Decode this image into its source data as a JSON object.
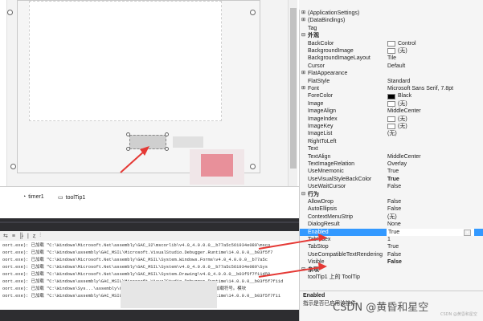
{
  "tray": {
    "items": [
      {
        "icon": "timer-icon",
        "label": "timer1"
      },
      {
        "icon": "tooltip-icon",
        "label": "toolTip1"
      }
    ]
  },
  "output": {
    "toolbar_glyphs": [
      "⇆",
      "≡",
      "╠",
      "|",
      "ȥ",
      "⫶"
    ],
    "lines": [
      "oort.exe): 已加载 \"C:\\Windows\\Microsoft.Net\\assembly\\GAC_32\\mscorlib\\v4.0_4.0.0.0__b77a5c561934e089\\msco",
      "oort.exe): 已加载 \"C:\\Windows\\assembly\\GAC_MSIL\\Microsoft.VisualStudio.Debugger.Runtime\\14.0.0.0__b03f5f7",
      "oort.exe): 已加载 \"C:\\Windows\\Microsoft.Net\\assembly\\GAC_MSIL\\System.Windows.Forms\\v4.0_4.0.0.0__b77a5c",
      "oort.exe): 已加载 \"C:\\Windows\\Microsoft.Net\\assembly\\GAC_MSIL\\System\\v4.0_4.0.0.0__b77a5c561934e089\\Sys",
      "oort.exe): 已加载 \"C:\\Windows\\Microsoft.Net\\assembly\\GAC_MSIL\\System.Drawing\\v4.0_4.0.0.0__b03f5f7f11d50",
      "oort.exe): 已加载 \"C:\\Windows\\assembly\\GAC_MSIL\\Microsoft.VisualStudio.Debugger.Runtime\\14.0.0.0__b03f5f7f11d",
      "oort.exe): 已加载 \"C:\\Windows\\Sys...\\assembly\\GAC_MSIL\\Accessibility.Desc\\14. 已跳过加载符号。模块",
      "oort.exe): 已加载 \"C:\\Windows\\assembly\\GAC_MSIL\\Microsoft.VisualStudio.Debugger.Runtime\\14.0.0.0__b03f5f7f11"
    ]
  },
  "properties": {
    "rows": [
      {
        "type": "expander",
        "name": "(ApplicationSettings)"
      },
      {
        "type": "expander",
        "name": "(DataBindings)"
      },
      {
        "type": "prop",
        "name": "Tag",
        "value": ""
      },
      {
        "type": "category",
        "name": "外观"
      },
      {
        "type": "prop",
        "name": "BackColor",
        "value": "Control",
        "swatch": "white"
      },
      {
        "type": "prop",
        "name": "BackgroundImage",
        "value": "(无)",
        "swatch": "white"
      },
      {
        "type": "prop",
        "name": "BackgroundImageLayout",
        "value": "Tile"
      },
      {
        "type": "prop",
        "name": "Cursor",
        "value": "Default"
      },
      {
        "type": "expander",
        "name": "FlatAppearance"
      },
      {
        "type": "prop",
        "name": "FlatStyle",
        "value": "Standard"
      },
      {
        "type": "expander",
        "name": "Font",
        "value": "Microsoft Sans Serif, 7.8pt"
      },
      {
        "type": "prop",
        "name": "ForeColor",
        "value": "Black",
        "swatch": "black"
      },
      {
        "type": "prop",
        "name": "Image",
        "value": "(无)",
        "swatch": "white"
      },
      {
        "type": "prop",
        "name": "ImageAlign",
        "value": "MiddleCenter"
      },
      {
        "type": "prop",
        "name": "ImageIndex",
        "value": "(无)",
        "swatch": "white"
      },
      {
        "type": "prop",
        "name": "ImageKey",
        "value": "(无)",
        "swatch": "white"
      },
      {
        "type": "prop",
        "name": "ImageList",
        "value": "(无)"
      },
      {
        "type": "prop",
        "name": "RightToLeft",
        "value": ""
      },
      {
        "type": "prop",
        "name": "Text",
        "value": ""
      },
      {
        "type": "prop",
        "name": "TextAlign",
        "value": "MiddleCenter"
      },
      {
        "type": "prop",
        "name": "TextImageRelation",
        "value": "Overlay"
      },
      {
        "type": "prop",
        "name": "UseMnemonic",
        "value": "True"
      },
      {
        "type": "prop",
        "name": "UseVisualStyleBackColor",
        "value": "True",
        "bold": true
      },
      {
        "type": "prop",
        "name": "UseWaitCursor",
        "value": "False"
      },
      {
        "type": "category",
        "name": "行为"
      },
      {
        "type": "prop",
        "name": "AllowDrop",
        "value": "False"
      },
      {
        "type": "prop",
        "name": "AutoEllipsis",
        "value": "False"
      },
      {
        "type": "prop",
        "name": "ContextMenuStrip",
        "value": "(无)"
      },
      {
        "type": "prop",
        "name": "DialogResult",
        "value": "None"
      },
      {
        "type": "prop",
        "name": "Enabled",
        "value": "True",
        "selected": true
      },
      {
        "type": "prop",
        "name": "TabIndex",
        "value": "1"
      },
      {
        "type": "prop",
        "name": "TabStop",
        "value": "True"
      },
      {
        "type": "prop",
        "name": "UseCompatibleTextRendering",
        "value": "False"
      },
      {
        "type": "prop",
        "name": "Visible",
        "value": "False",
        "bold": true
      },
      {
        "type": "category",
        "name": "杂项"
      },
      {
        "type": "prop",
        "name": "toolTip1 上的 ToolTip",
        "value": ""
      }
    ]
  },
  "description": {
    "title": "Enabled",
    "text": "指示是否已启用该控件"
  },
  "watermark": {
    "text": "CSDN @黄昏和星空",
    "small": "CSDN @黄昏和星空"
  },
  "colors": {
    "selected": "#3399ff",
    "arrow": "#e53935",
    "dark_chrome": "#2d2d30"
  }
}
